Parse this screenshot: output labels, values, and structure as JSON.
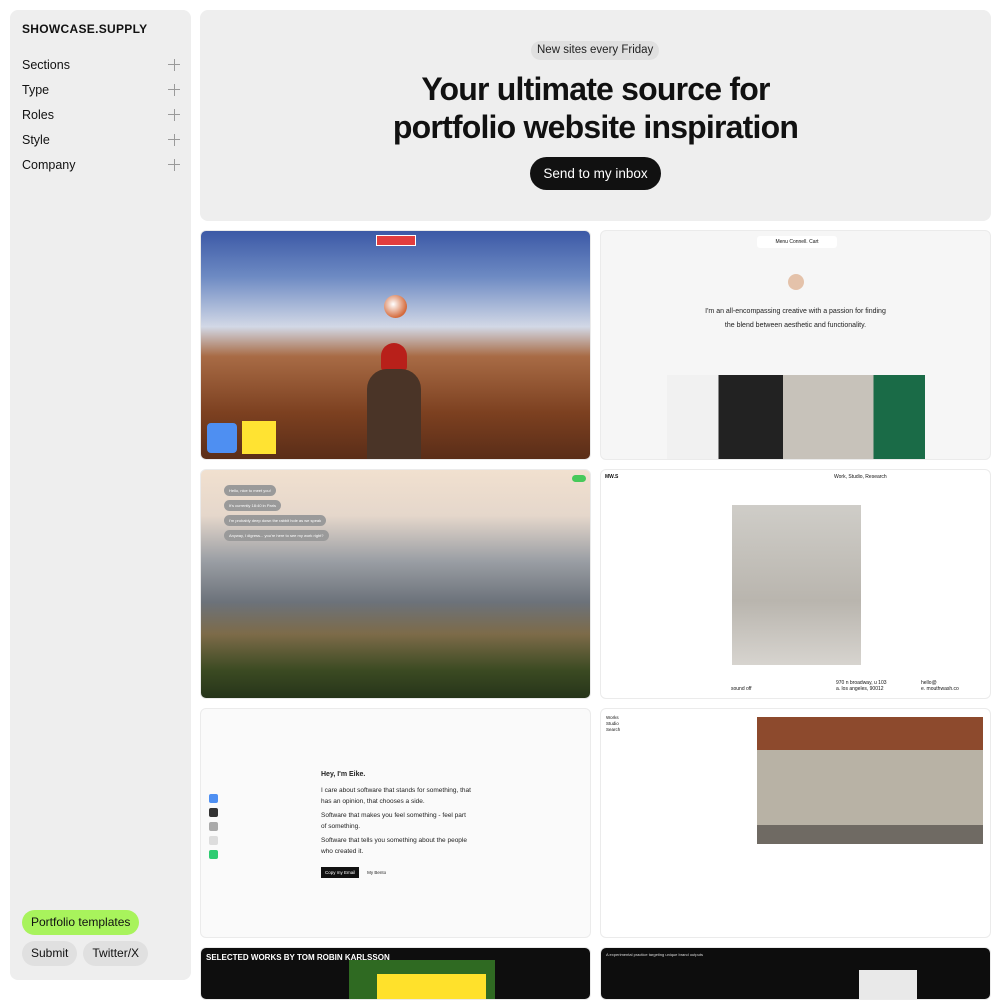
{
  "brand": "SHOWCASE.SUPPLY",
  "filters": [
    "Sections",
    "Type",
    "Roles",
    "Style",
    "Company"
  ],
  "sidebar_buttons": {
    "templates": "Portfolio templates",
    "submit": "Submit",
    "twitter": "Twitter/X"
  },
  "hero": {
    "tag": "New sites every Friday",
    "title_line1": "Your ultimate source for",
    "title_line2": "portfolio website inspiration",
    "cta": "Send to my inbox"
  },
  "card2": {
    "nav": "Menu   Connell.   Cart",
    "text_line1": "I'm an all-encompassing creative with a passion for finding",
    "text_line2": "the blend between aesthetic and functionality."
  },
  "card3": {
    "messages": [
      "Hello, nice to meet you!",
      "It's currently 18:40 in Paris",
      "I'm probably deep down the rabbit hole as we speak",
      "Anyway, I digress... you're here to see my work right?"
    ]
  },
  "card4": {
    "brand": "MW.S",
    "nav": "Work, Studio, Research",
    "foot_left": "sound off",
    "foot_mid": "970 n broadway, u 103",
    "foot_mid2": "a. los angeles, 90012",
    "foot_right": "hello@",
    "foot_right2": "e. mouthwash.co"
  },
  "card5": {
    "heading": "Hey, I'm Eike.",
    "p1": "I care about software that stands for something, that has an opinion, that chooses a side.",
    "p2": "Software that makes you feel something - feel part of something.",
    "p3": "Software that tells you something about the people who created it.",
    "btn1": "Copy my Email",
    "btn2": "My Bento"
  },
  "card6": {
    "nav": [
      "Works",
      "Studio",
      "Search"
    ]
  },
  "card7": {
    "title": "SELECTED WORKS BY TOM ROBIN KARLSSON"
  },
  "card8": {
    "text": "A experimental practice targeting unique brand outputs"
  },
  "colors": {
    "accent_green": "#a8f35c",
    "cta_black": "#111111",
    "panel_grey": "#eeeeee"
  }
}
